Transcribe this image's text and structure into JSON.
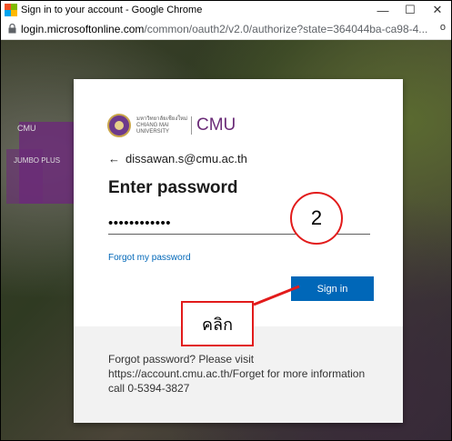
{
  "window": {
    "title": "Sign in to your account - Google Chrome",
    "minimize": "—",
    "maximize": "☐",
    "close": "✕"
  },
  "address": {
    "domain": "login.microsoftonline.com",
    "path": "/common/oauth2/v2.0/authorize?state=364044ba-ca98-4..."
  },
  "background": {
    "labels": [
      "CMU",
      "JUMBO PLUS"
    ]
  },
  "card": {
    "logo_thai": "มหาวิทยาลัยเชียงใหม่",
    "logo_english": "CHIANG MAI UNIVERSITY",
    "logo_cmu": "CMU",
    "back_arrow": "←",
    "account": "dissawan.s@cmu.ac.th",
    "heading": "Enter password",
    "password_value": "••••••••••••",
    "forgot_link": "Forgot my password",
    "signin_label": "Sign in",
    "footer_text": "Forgot password? Please visit https://account.cmu.ac.th/Forget for more information call 0-5394-3827"
  },
  "annotations": {
    "step_number": "2",
    "click_label": "คลิก"
  },
  "colors": {
    "accent": "#0067b8",
    "callout": "#e21b1b",
    "brand": "#6b2c78"
  }
}
